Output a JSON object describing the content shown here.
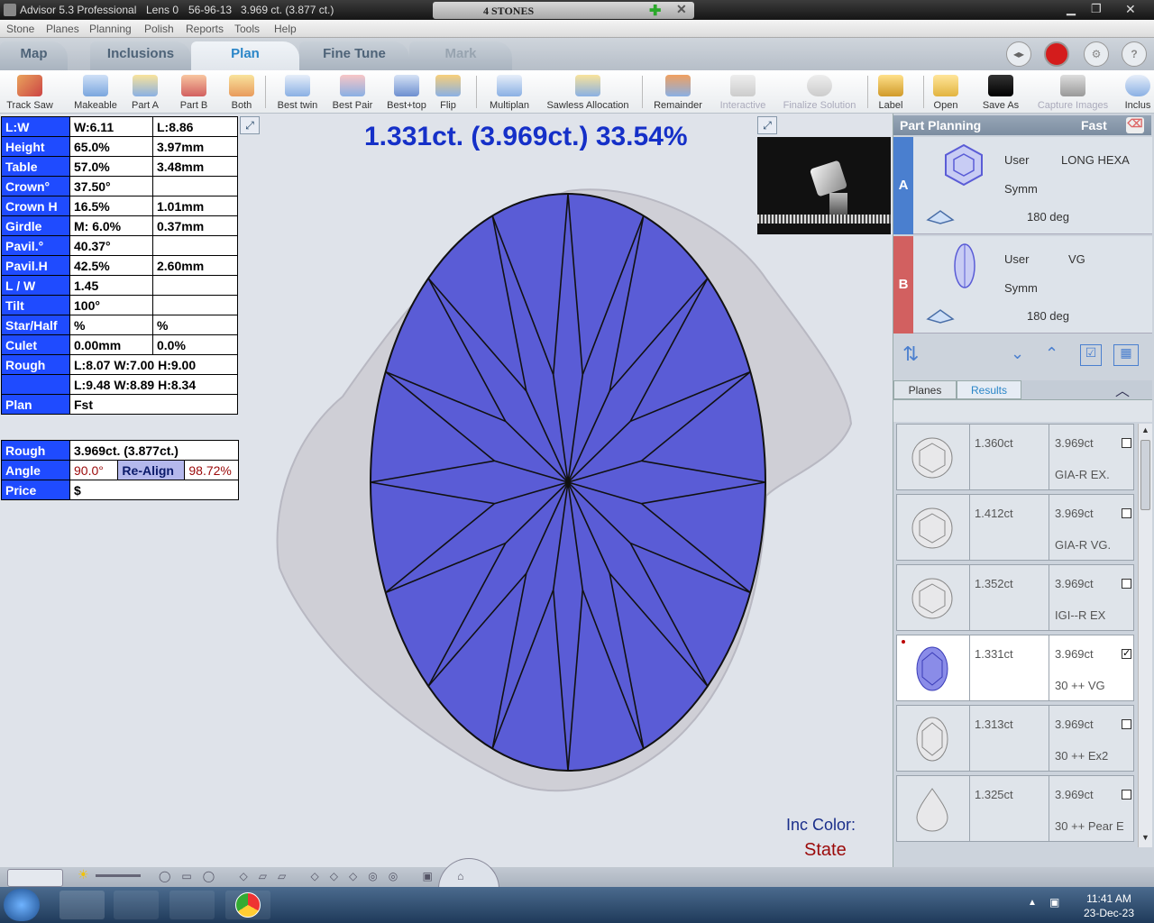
{
  "titlebar": {
    "app": "Advisor 5.3 Professional",
    "lens": "Lens 0",
    "code": "56-96-13",
    "weight": "3.969 ct. (3.877 ct.)",
    "stones": "4 STONES"
  },
  "menu": [
    "Stone",
    "Planes",
    "Planning",
    "Polish",
    "Reports",
    "Tools",
    "Help"
  ],
  "tabs": [
    "Map",
    "Inclusions",
    "Plan",
    "Fine Tune",
    "Mark"
  ],
  "active_tab": "Plan",
  "toolbar": [
    "Track Saw",
    "Makeable",
    "Part A",
    "Part B",
    "Both",
    "Best twin",
    "Best Pair",
    "Best+top",
    "Flip",
    "Multiplan",
    "Sawless Allocation",
    "Remainder",
    "Interactive",
    "Finalize Solution",
    "Label",
    "Open",
    "Save As",
    "Capture Images",
    "Inclus"
  ],
  "props": [
    {
      "k": "L:W",
      "v1": "W:6.11",
      "v2": "L:8.86"
    },
    {
      "k": "Height",
      "v1": "65.0%",
      "v2": "3.97mm"
    },
    {
      "k": "Table",
      "v1": "57.0%",
      "v2": "3.48mm"
    },
    {
      "k": "Crown°",
      "v1": "37.50°",
      "v2": ""
    },
    {
      "k": "Crown H",
      "v1": "16.5%",
      "v2": "1.01mm"
    },
    {
      "k": "Girdle",
      "v1": "M: 6.0%",
      "v2": "0.37mm"
    },
    {
      "k": "Pavil.°",
      "v1": "40.37°",
      "v2": ""
    },
    {
      "k": "Pavil.H",
      "v1": "42.5%",
      "v2": "2.60mm"
    },
    {
      "k": "L / W",
      "v1": "1.45",
      "v2": ""
    },
    {
      "k": "Tilt",
      "v1": "100°",
      "v2": ""
    },
    {
      "k": "Star/Half",
      "v1": "%",
      "v2": "%"
    },
    {
      "k": "Culet",
      "v1": "0.00mm",
      "v2": "0.0%"
    },
    {
      "k": "Rough",
      "v": "L:8.07 W:7.00 H:9.00"
    },
    {
      "k": "",
      "v": "L:9.48 W:8.89 H:8.34"
    },
    {
      "k": "Plan",
      "v": "Fst"
    }
  ],
  "rough": {
    "label": "Rough",
    "value": "3.969ct. (3.877ct.)",
    "angle_label": "Angle",
    "angle": "90.0°",
    "realign_label": "Re-Align",
    "realign": "98.72%",
    "price_label": "Price",
    "price": "$"
  },
  "headline": "1.331ct. (3.969ct.) 33.54%",
  "inc_color": "Inc Color:",
  "state": "State",
  "part_planning": {
    "title": "Part Planning",
    "mode": "Fast"
  },
  "parts": [
    {
      "label": "A",
      "user": "User",
      "shape": "LONG HEXA",
      "symm": "Symm",
      "deg": "180 deg",
      "color": "#4a7fcf"
    },
    {
      "label": "B",
      "user": "User",
      "shape": "VG",
      "symm": "Symm",
      "deg": "180 deg",
      "color": "#d26060"
    }
  ],
  "subtabs": [
    "Planes",
    "Results"
  ],
  "results": [
    {
      "ct": "1.360ct",
      "total": "3.969ct",
      "grade": "GIA-R EX.",
      "checked": false,
      "shape": "round"
    },
    {
      "ct": "1.412ct",
      "total": "3.969ct",
      "grade": "GIA-R VG.",
      "checked": false,
      "shape": "round"
    },
    {
      "ct": "1.352ct",
      "total": "3.969ct",
      "grade": "IGI--R EX",
      "checked": false,
      "shape": "round"
    },
    {
      "ct": "1.331ct",
      "total": "3.969ct",
      "grade": "30 ++ VG",
      "checked": true,
      "shape": "oval"
    },
    {
      "ct": "1.313ct",
      "total": "3.969ct",
      "grade": "30 ++ Ex2",
      "checked": false,
      "shape": "oval"
    },
    {
      "ct": "1.325ct",
      "total": "3.969ct",
      "grade": "30 ++ Pear E",
      "checked": false,
      "shape": "pear"
    }
  ],
  "clock": {
    "time": "11:41 AM",
    "date": "23-Dec-23"
  },
  "colors": {
    "stone_fill": "#5a5cd6",
    "rough": "#cfcfd6",
    "label_bg": "#1f4bff",
    "headline": "#1530c8"
  }
}
